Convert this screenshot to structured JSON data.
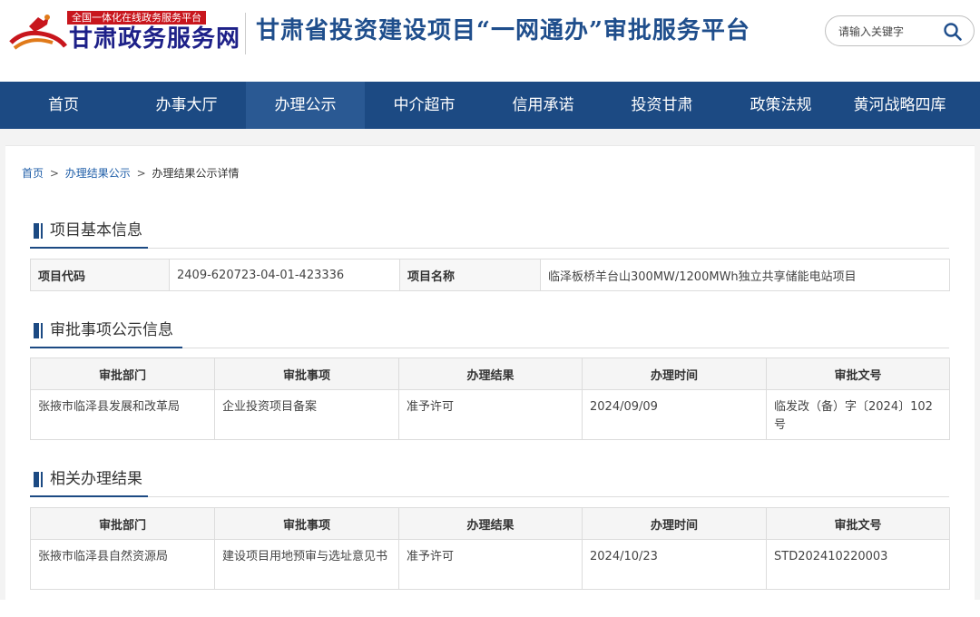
{
  "header": {
    "logo_badge": "全国一体化在线政务服务平台",
    "logo_name": "甘肃政务服务网",
    "site_title": "甘肃省投资建设项目“一网通办”审批服务平台",
    "search_placeholder": "请输入关键字"
  },
  "nav": {
    "items": [
      "首页",
      "办事大厅",
      "办理公示",
      "中介超市",
      "信用承诺",
      "投资甘肃",
      "政策法规",
      "黄河战略四库"
    ],
    "active_index": 2
  },
  "breadcrumb": {
    "home": "首页",
    "sep1": ">",
    "list": "办理结果公示",
    "sep2": ">",
    "current": "办理结果公示详情"
  },
  "basic": {
    "title": "项目基本信息",
    "code_label": "项目代码",
    "code_value": "2409-620723-04-01-423336",
    "name_label": "项目名称",
    "name_value": "临泽板桥羊台山300MW/1200MWh独立共享储能电站项目"
  },
  "approval": {
    "title": "审批事项公示信息",
    "headers": [
      "审批部门",
      "审批事项",
      "办理结果",
      "办理时间",
      "审批文号"
    ],
    "rows": [
      [
        "张掖市临泽县发展和改革局",
        "企业投资项目备案",
        "准予许可",
        "2024/09/09",
        "临发改（备）字〔2024〕102号"
      ]
    ]
  },
  "related": {
    "title": "相关办理结果",
    "headers": [
      "审批部门",
      "审批事项",
      "办理结果",
      "办理时间",
      "审批文号"
    ],
    "rows": [
      [
        "张掖市临泽县自然资源局",
        "建设项目用地预审与选址意见书",
        "准予许可",
        "2024/10/23",
        "STD202410220003"
      ]
    ]
  },
  "colors": {
    "nav_bg": "#1c4a83",
    "nav_active": "#2a5993",
    "title_blue": "#1f4e8c",
    "badge_red": "#c8161d"
  }
}
